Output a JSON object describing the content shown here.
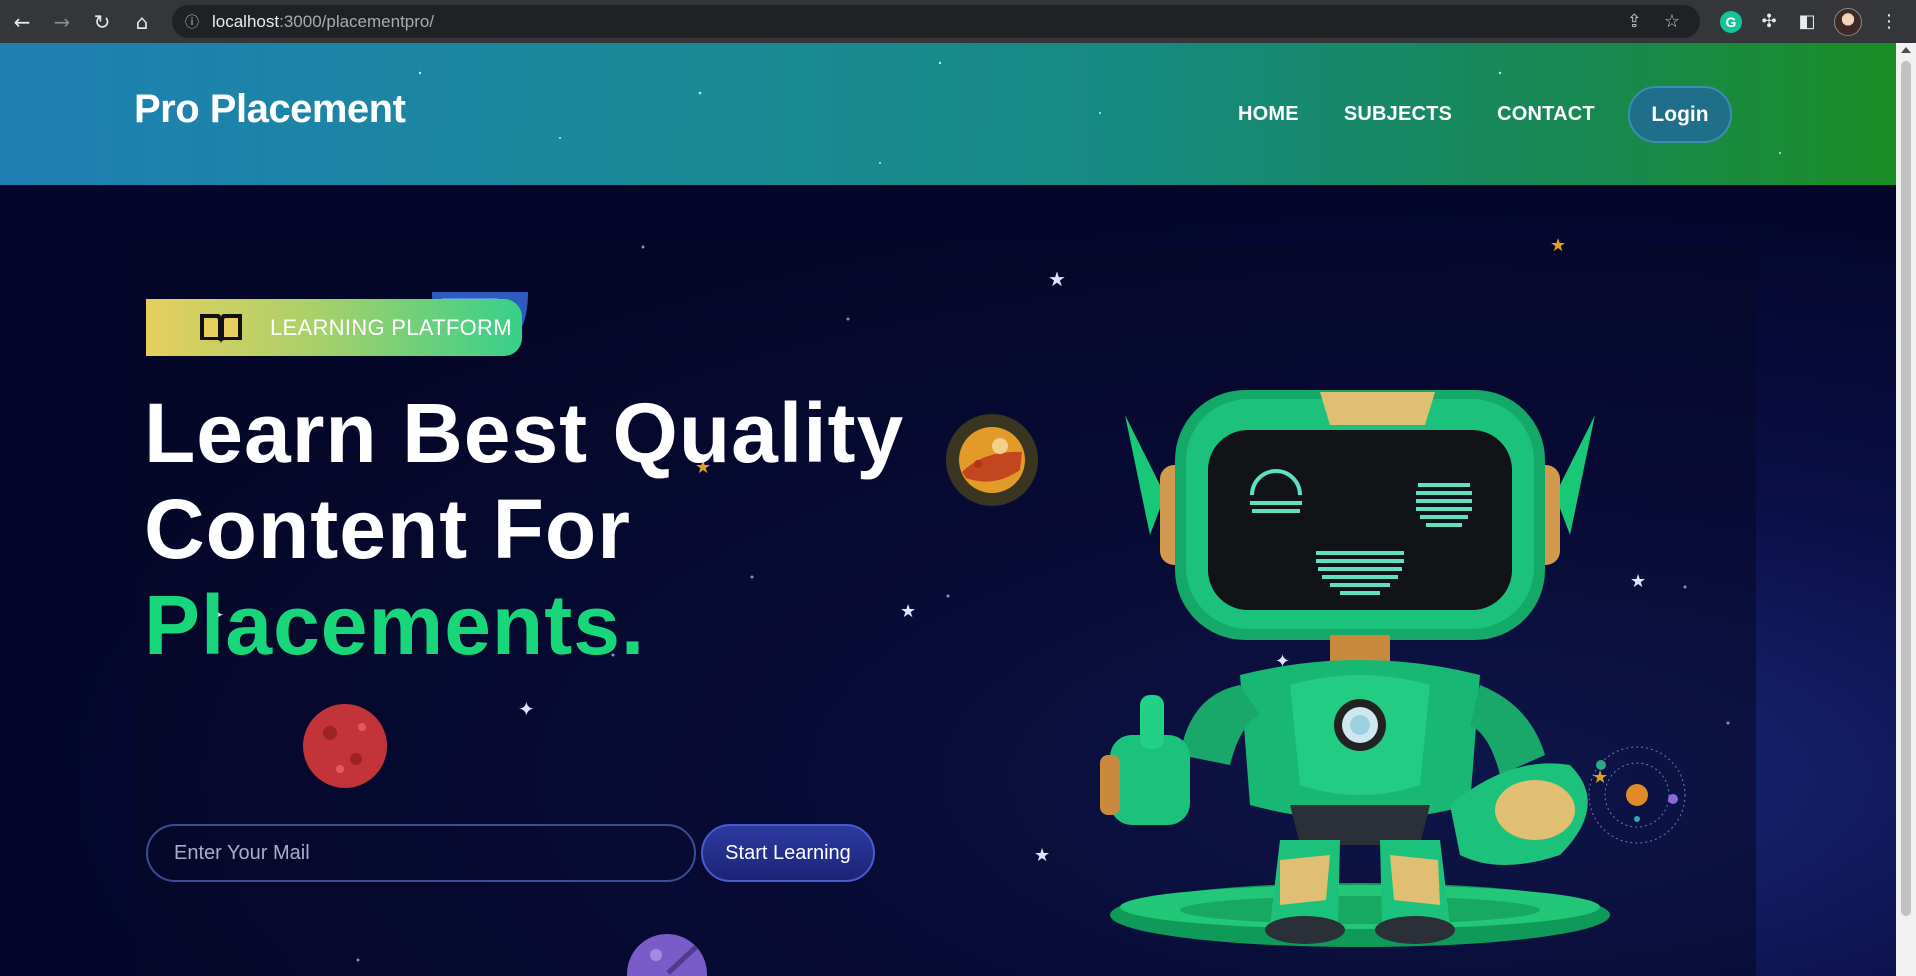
{
  "browser": {
    "url_host": "localhost",
    "url_path": ":3000/placementpro/",
    "extension_badge": "G"
  },
  "navbar": {
    "brand": "Pro Placement",
    "menu": [
      {
        "label": "HOME"
      },
      {
        "label": "SUBJECTS"
      },
      {
        "label": "CONTACT"
      }
    ],
    "login_label": "Login"
  },
  "hero": {
    "badge_label": "LEARNING PLATFORM",
    "headline_line1": "Learn Best Quality",
    "headline_line2": "Content For",
    "headline_accent": "Placements.",
    "email_placeholder": "Enter Your Mail",
    "cta_label": "Start Learning"
  },
  "colors": {
    "accent_green": "#18d77a",
    "hero_bg": "#04062a",
    "cta_bg": "#1c2477"
  },
  "icons": {
    "badge": "open-book-icon",
    "mascot": "robot-illustration"
  }
}
